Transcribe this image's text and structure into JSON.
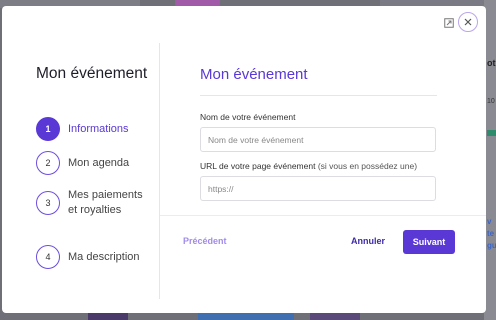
{
  "background": {
    "right_edge_fragments": [
      "otr",
      "10",
      "v",
      "te",
      "gu"
    ]
  },
  "modal": {
    "icons": {
      "expand": "expand-icon",
      "close": "close-icon"
    },
    "sidebar": {
      "title": "Mon événement",
      "steps": [
        {
          "number": "1",
          "label": "Informations",
          "active": true
        },
        {
          "number": "2",
          "label": "Mon agenda",
          "active": false
        },
        {
          "number": "3",
          "label": "Mes paiements et royalties",
          "active": false
        },
        {
          "number": "4",
          "label": "Ma description",
          "active": false
        }
      ]
    },
    "content": {
      "title": "Mon événement",
      "name_field": {
        "label": "Nom de votre événement",
        "value": "",
        "placeholder": "Nom de votre événement"
      },
      "url_field": {
        "label": "URL de votre page événement",
        "hint": "(si vous en possédez une)",
        "value": "",
        "placeholder": "https://"
      }
    },
    "footer": {
      "previous_label": "Précédent",
      "cancel_label": "Annuler",
      "next_label": "Suivant"
    }
  },
  "colors": {
    "accent": "#5a38d6",
    "accent_light": "#a28be8",
    "overlay": "#6f6f78"
  }
}
